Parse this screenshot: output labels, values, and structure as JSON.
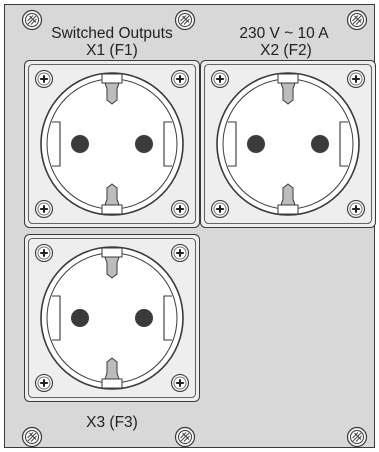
{
  "panel": {
    "title": "Switched Outputs",
    "rating": "230 V ~  10 A",
    "sockets": [
      {
        "label": "X1 (F1)"
      },
      {
        "label": "X2 (F2)"
      },
      {
        "label": "X3 (F3)"
      }
    ]
  },
  "colors": {
    "panel_fill": "#d8d8d8",
    "module_fill": "#eeeeee",
    "outline": "#3a3a3a",
    "socket_hole": "#3a3a3a"
  },
  "icons": {
    "panel_screw": "mounting-screw-icon",
    "module_screw": "phillips-screw-icon"
  }
}
